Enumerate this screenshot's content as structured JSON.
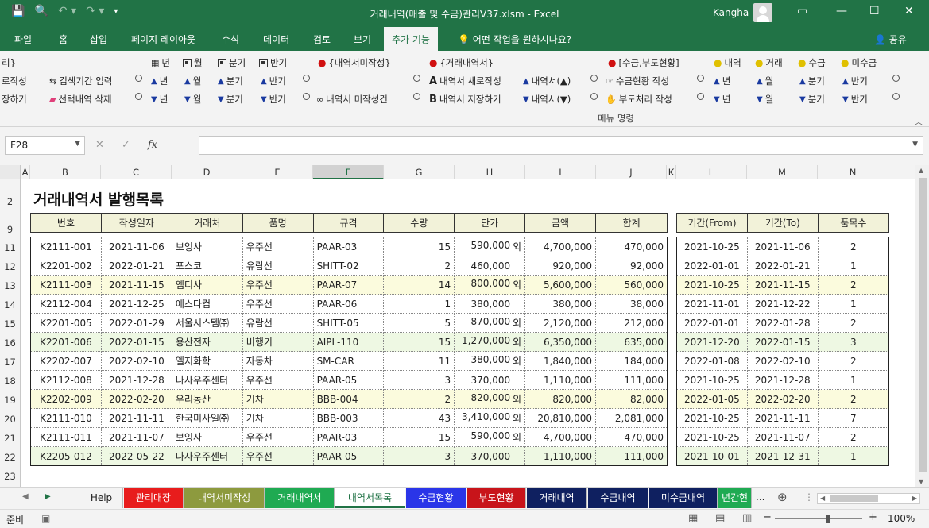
{
  "window": {
    "title": "거래내역(매출 및 수금)관리V37.xlsm  -  Excel",
    "user": "Kangha"
  },
  "tabs": [
    "파일",
    "홈",
    "삽입",
    "페이지 레이아웃",
    "수식",
    "데이터",
    "검토",
    "보기",
    "추가 기능"
  ],
  "tell_me": "어떤 작업을 원하시나요?",
  "share": "공유",
  "ribbon": {
    "row0": {
      "clip": "리}",
      "year": "년",
      "month": "월",
      "quarter": "분기",
      "half": "반기",
      "g1": "{내역서미작성}",
      "g2": "{거래내역서}",
      "g3": "[수금,부도현황]",
      "y1": "내역",
      "y2": "거래",
      "y3": "수금",
      "y4": "미수금"
    },
    "row1": {
      "clip": "로작성",
      "search": "검색기간 입력",
      "year": "년",
      "month": "월",
      "quarter": "분기",
      "half": "반기",
      "new_doc": "내역서 새로작성",
      "doc_up": "내역서(▲)",
      "collect": "수금현황 작성",
      "year2": "년",
      "month2": "월",
      "quarter2": "분기",
      "half2": "반기"
    },
    "row2": {
      "clip": "장하기",
      "delete": "선택내역 삭제",
      "year": "년",
      "month": "월",
      "quarter": "분기",
      "half": "반기",
      "unwritten": "내역서 미작성건",
      "save_doc": "내역서 저장하기",
      "doc_dn": "내역서(▼)",
      "bounce": "부도처리 작성",
      "year2": "년",
      "month2": "월",
      "quarter2": "분기",
      "half2": "반기"
    },
    "group_label": "메뉴 명령"
  },
  "formula_bar": {
    "cell_ref": "F28",
    "formula": ""
  },
  "columns": [
    "A",
    "B",
    "C",
    "D",
    "E",
    "F",
    "G",
    "H",
    "I",
    "J",
    "K",
    "L",
    "M",
    "N"
  ],
  "rows": [
    "2",
    "9",
    "11",
    "12",
    "13",
    "14",
    "15",
    "16",
    "17",
    "18",
    "19",
    "20",
    "21",
    "22",
    "23"
  ],
  "sheet_title": "거래내역서 발행목록",
  "main_table": {
    "headers": [
      "번호",
      "작성일자",
      "거래처",
      "품명",
      "규격",
      "수량",
      "단가",
      "금액",
      "합계"
    ],
    "rows": [
      [
        "K2111-001",
        "2021-11-06",
        "보잉사",
        "우주선",
        "PAAR-03",
        "15",
        "590,000",
        "외",
        "4,700,000",
        "470,000"
      ],
      [
        "K2201-002",
        "2022-01-21",
        "포스코",
        "유람선",
        "SHITT-02",
        "2",
        "460,000",
        "",
        "920,000",
        "92,000"
      ],
      [
        "K2111-003",
        "2021-11-15",
        "엠디사",
        "우주선",
        "PAAR-07",
        "14",
        "800,000",
        "외",
        "5,600,000",
        "560,000"
      ],
      [
        "K2112-004",
        "2021-12-25",
        "에스다컴",
        "우주선",
        "PAAR-06",
        "1",
        "380,000",
        "",
        "380,000",
        "38,000"
      ],
      [
        "K2201-005",
        "2022-01-29",
        "서울시스템㈜",
        "유람선",
        "SHITT-05",
        "5",
        "870,000",
        "외",
        "2,120,000",
        "212,000"
      ],
      [
        "K2201-006",
        "2022-01-15",
        "용산전자",
        "비행기",
        "AIPL-110",
        "15",
        "1,270,000",
        "외",
        "6,350,000",
        "635,000"
      ],
      [
        "K2202-007",
        "2022-02-10",
        "엘지화학",
        "자동차",
        "SM-CAR",
        "11",
        "380,000",
        "외",
        "1,840,000",
        "184,000"
      ],
      [
        "K2112-008",
        "2021-12-28",
        "나사우주센터",
        "우주선",
        "PAAR-05",
        "3",
        "370,000",
        "",
        "1,110,000",
        "111,000"
      ],
      [
        "K2202-009",
        "2022-02-20",
        "우리농산",
        "기차",
        "BBB-004",
        "2",
        "820,000",
        "외",
        "820,000",
        "82,000"
      ],
      [
        "K2111-010",
        "2021-11-11",
        "한국미사일㈜",
        "기차",
        "BBB-003",
        "43",
        "3,410,000",
        "외",
        "20,810,000",
        "2,081,000"
      ],
      [
        "K2111-011",
        "2021-11-07",
        "보잉사",
        "우주선",
        "PAAR-03",
        "15",
        "590,000",
        "외",
        "4,700,000",
        "470,000"
      ],
      [
        "K2205-012",
        "2022-05-22",
        "나사우주센터",
        "우주선",
        "PAAR-05",
        "3",
        "370,000",
        "",
        "1,110,000",
        "111,000"
      ]
    ]
  },
  "side_table": {
    "headers": [
      "기간(From)",
      "기간(To)",
      "품목수"
    ],
    "rows": [
      [
        "2021-10-25",
        "2021-11-06",
        "2"
      ],
      [
        "2022-01-01",
        "2022-01-21",
        "1"
      ],
      [
        "2021-10-25",
        "2021-11-15",
        "2"
      ],
      [
        "2021-11-01",
        "2021-12-22",
        "1"
      ],
      [
        "2022-01-01",
        "2022-01-28",
        "2"
      ],
      [
        "2021-12-20",
        "2022-01-15",
        "3"
      ],
      [
        "2022-01-08",
        "2022-02-10",
        "2"
      ],
      [
        "2021-10-25",
        "2021-12-28",
        "1"
      ],
      [
        "2022-01-05",
        "2022-02-20",
        "2"
      ],
      [
        "2021-10-25",
        "2021-11-11",
        "7"
      ],
      [
        "2021-10-25",
        "2021-11-07",
        "2"
      ],
      [
        "2021-10-01",
        "2021-12-31",
        "1"
      ]
    ]
  },
  "sheet_tabs": [
    {
      "label": "Help",
      "bg": "#f3f3f3",
      "fg": "#222222"
    },
    {
      "label": "관리대장",
      "bg": "#e81c1c",
      "fg": "#ffffff"
    },
    {
      "label": "내역서미작성",
      "bg": "#8d9a3e",
      "fg": "#ffffff"
    },
    {
      "label": "거래내역서",
      "bg": "#1faa52",
      "fg": "#ffffff"
    },
    {
      "label": "내역서목록",
      "bg": "#ffffff",
      "fg": "#217346"
    },
    {
      "label": "수금현황",
      "bg": "#2a35e8",
      "fg": "#ffffff"
    },
    {
      "label": "부도현황",
      "bg": "#c8141a",
      "fg": "#ffffff"
    },
    {
      "label": "거래내역",
      "bg": "#0f2060",
      "fg": "#ffffff"
    },
    {
      "label": "수금내역",
      "bg": "#0f2060",
      "fg": "#ffffff"
    },
    {
      "label": "미수금내역",
      "bg": "#0f2060",
      "fg": "#ffffff"
    },
    {
      "label": "년간현",
      "bg": "#1faa52",
      "fg": "#ffffff"
    }
  ],
  "more_tabs": "...",
  "status": {
    "ready": "준비",
    "zoom": "100%"
  },
  "colors": {
    "excel_green": "#217346",
    "row_yellow": "#fbfbdd",
    "row_green": "#eef8e3",
    "header_fill": "#f2f2d9"
  }
}
